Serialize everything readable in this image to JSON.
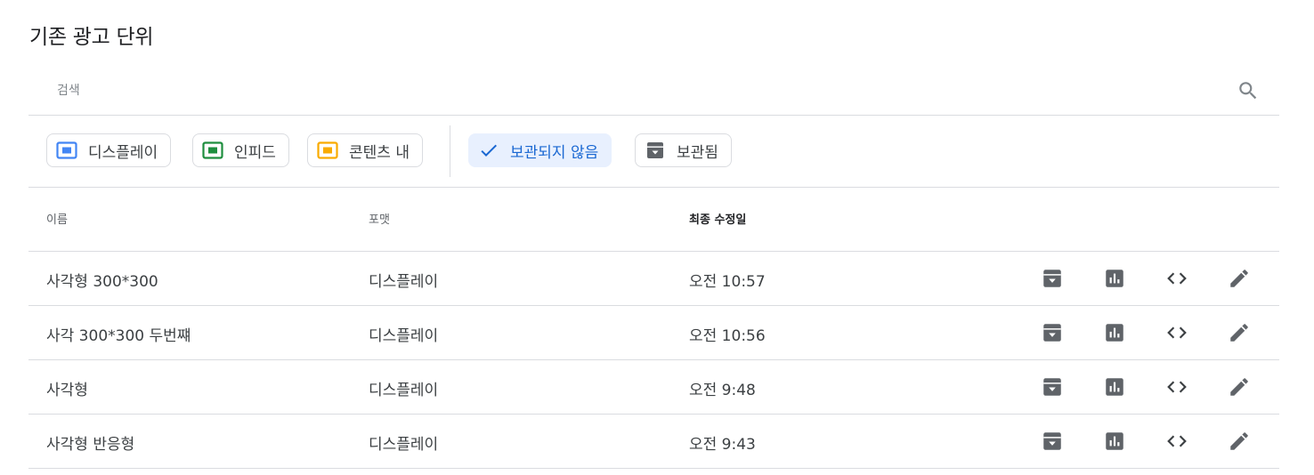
{
  "page_title": "기존 광고 단위",
  "search": {
    "placeholder": "검색",
    "value": "",
    "icon": "search-icon"
  },
  "filters": {
    "format_chips": [
      {
        "label": "디스플레이",
        "icon": "display-icon",
        "color": "#4285f4"
      },
      {
        "label": "인피드",
        "icon": "infeed-icon",
        "color": "#1e8e3e"
      },
      {
        "label": "콘텐츠 내",
        "icon": "in-article-icon",
        "color": "#f9ab00"
      }
    ],
    "status_chips": [
      {
        "label": "보관되지 않음",
        "icon": "check-icon",
        "selected": true
      },
      {
        "label": "보관됨",
        "icon": "archive-icon",
        "selected": false
      }
    ]
  },
  "table": {
    "columns": [
      {
        "label": "이름",
        "bold": false
      },
      {
        "label": "포맷",
        "bold": false
      },
      {
        "label": "최종 수정일",
        "bold": true
      }
    ],
    "rows": [
      {
        "name": "사각형 300*300",
        "format": "디스플레이",
        "modified": "오전 10:57"
      },
      {
        "name": "사각 300*300 두번쨰",
        "format": "디스플레이",
        "modified": "오전 10:56"
      },
      {
        "name": "사각형",
        "format": "디스플레이",
        "modified": "오전 9:48"
      },
      {
        "name": "사각형 반응형",
        "format": "디스플레이",
        "modified": "오전 9:43"
      }
    ],
    "row_actions": [
      "archive-icon",
      "report-icon",
      "code-icon",
      "edit-icon"
    ]
  },
  "colors": {
    "accent": "#1967d2",
    "selected_bg": "#e8f0fe",
    "icon_gray": "#5f6368",
    "divider": "#dadce0"
  }
}
